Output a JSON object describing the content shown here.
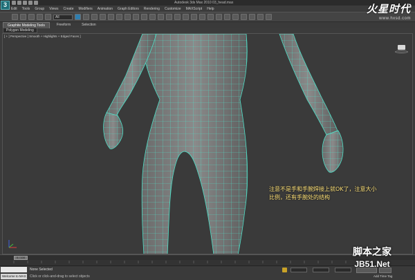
{
  "window": {
    "title": "Autodesk 3ds Max 2010    03_head.max",
    "app_logo": "3"
  },
  "menu": [
    "Edit",
    "Tools",
    "Group",
    "Views",
    "Create",
    "Modifiers",
    "Animation",
    "Graph Editors",
    "Rendering",
    "Customize",
    "MAXScript",
    "Help"
  ],
  "toolbar": {
    "selection_filter": "All"
  },
  "ribbon": {
    "tabs": [
      "Graphite Modeling Tools",
      "Freeform",
      "Selection"
    ],
    "panel": "Polygon Modeling"
  },
  "viewport": {
    "label": "[ + ] Perspective ] Smooth + Highlights + Edged Faces ]",
    "annotation_line1": "注意不是手和手腕焊接上就OK了，注意大小",
    "annotation_line2": "比例，还有手腕处的结构"
  },
  "timeline": {
    "slider": "0 / 100"
  },
  "status": {
    "welcome": "Welcome to MAX",
    "selected": "None Selected",
    "prompt": "Click or click-and-drag to select objects",
    "add_time_tag": "Add Time Tag"
  },
  "watermarks": {
    "hxsd_main": "火星时代",
    "hxsd_url": "www.hxsd.com",
    "jb51_cn": "脚本之家",
    "jb51_en": "JB51.Net"
  },
  "colors": {
    "mesh_shade": "#7d7d7d",
    "mesh_wire": "#4fe0c8",
    "annotation": "#ffe27a",
    "viewport_bg": "#3a3a3a"
  }
}
